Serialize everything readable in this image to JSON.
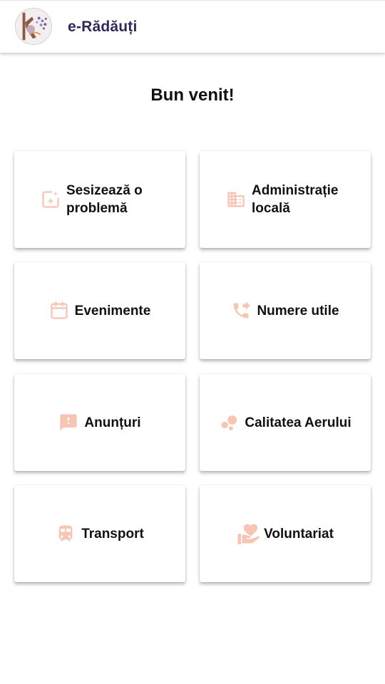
{
  "header": {
    "title": "e-Rădăuți",
    "logo_icon": "city-logo-icon"
  },
  "welcome": "Bun venit!",
  "accent_color": "#f8c4b4",
  "tiles": [
    {
      "label": "Sesizează o problemă",
      "icon": "report-issue-icon"
    },
    {
      "label": "Administrație locală",
      "icon": "building-icon"
    },
    {
      "label": "Evenimente",
      "icon": "calendar-icon"
    },
    {
      "label": "Numere utile",
      "icon": "phone-forward-icon"
    },
    {
      "label": "Anunțuri",
      "icon": "announcement-icon"
    },
    {
      "label": "Calitatea Aerului",
      "icon": "bubbles-icon"
    },
    {
      "label": "Transport",
      "icon": "train-icon"
    },
    {
      "label": "Voluntariat",
      "icon": "heart-hand-icon"
    }
  ]
}
